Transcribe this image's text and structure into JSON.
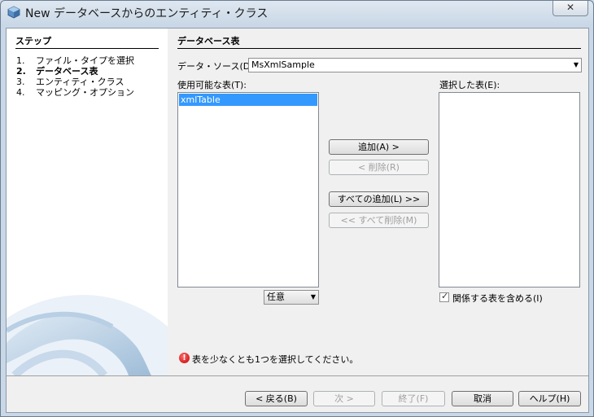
{
  "window": {
    "title": "New データベースからのエンティティ・クラス",
    "close_glyph": "✕"
  },
  "steps": {
    "title": "ステップ",
    "items": [
      {
        "num": "1.",
        "label": "ファイル・タイプを選択"
      },
      {
        "num": "2.",
        "label": "データベース表"
      },
      {
        "num": "3.",
        "label": "エンティティ・クラス"
      },
      {
        "num": "4.",
        "label": "マッピング・オプション"
      }
    ]
  },
  "main": {
    "section_title": "データベース表",
    "datasource_label": "データ・ソース(D):",
    "datasource_value": "MsXmlSample",
    "available_label": "使用可能な表(T):",
    "available_items": [
      "xmlTable"
    ],
    "selected_label": "選択した表(E):",
    "selected_items": [],
    "filter_value": "任意",
    "buttons": {
      "add": "追加(A) >",
      "remove": "< 削除(R)",
      "add_all": "すべての追加(L) >>",
      "remove_all": "<< すべて削除(M)"
    },
    "include_related_label": "関係する表を含める(I)",
    "error_message": "表を少なくとも1つを選択してください。"
  },
  "footer": {
    "back": "< 戻る(B)",
    "next": "次 >",
    "finish": "終了(F)",
    "cancel": "取消",
    "help": "ヘルプ(H)"
  }
}
